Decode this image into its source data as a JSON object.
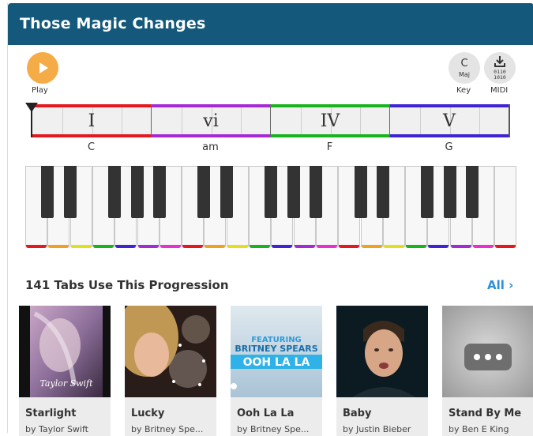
{
  "header": {
    "title": "Those Magic Changes"
  },
  "controls": {
    "play_label": "Play",
    "key_label": "Key",
    "key_value": "C",
    "key_mode": "Maj",
    "midi_label": "MIDI",
    "midi_bits_top": "0110",
    "midi_bits_bottom": "1010"
  },
  "progression": [
    {
      "numeral": "I",
      "chord": "C",
      "color": "#e3191f"
    },
    {
      "numeral": "vi",
      "chord": "am",
      "color": "#a42ad6"
    },
    {
      "numeral": "IV",
      "chord": "F",
      "color": "#19b31e"
    },
    {
      "numeral": "V",
      "chord": "G",
      "color": "#3f24d6"
    }
  ],
  "piano_colors": [
    "#e3191f",
    "#f0a122",
    "#e2df1f",
    "#19b31e",
    "#3f24d6",
    "#a42ad6",
    "#e82fd0"
  ],
  "tabs_section": {
    "title": "141 Tabs Use This Progression",
    "all_label": "All ›"
  },
  "cards": [
    {
      "title": "Starlight",
      "artist": "by Taylor Swift",
      "signature": "Taylor Swift"
    },
    {
      "title": "Lucky",
      "artist": "by Britney Spe..."
    },
    {
      "title": "Ooh La La",
      "artist": "by Britney Spe...",
      "banner_top": "FEATURING",
      "banner_mid": "BRITNEY SPEARS",
      "banner_bot": "OOH LA LA"
    },
    {
      "title": "Baby",
      "artist": "by Justin Bieber"
    },
    {
      "title": "Stand By Me",
      "artist": "by Ben E King"
    }
  ]
}
